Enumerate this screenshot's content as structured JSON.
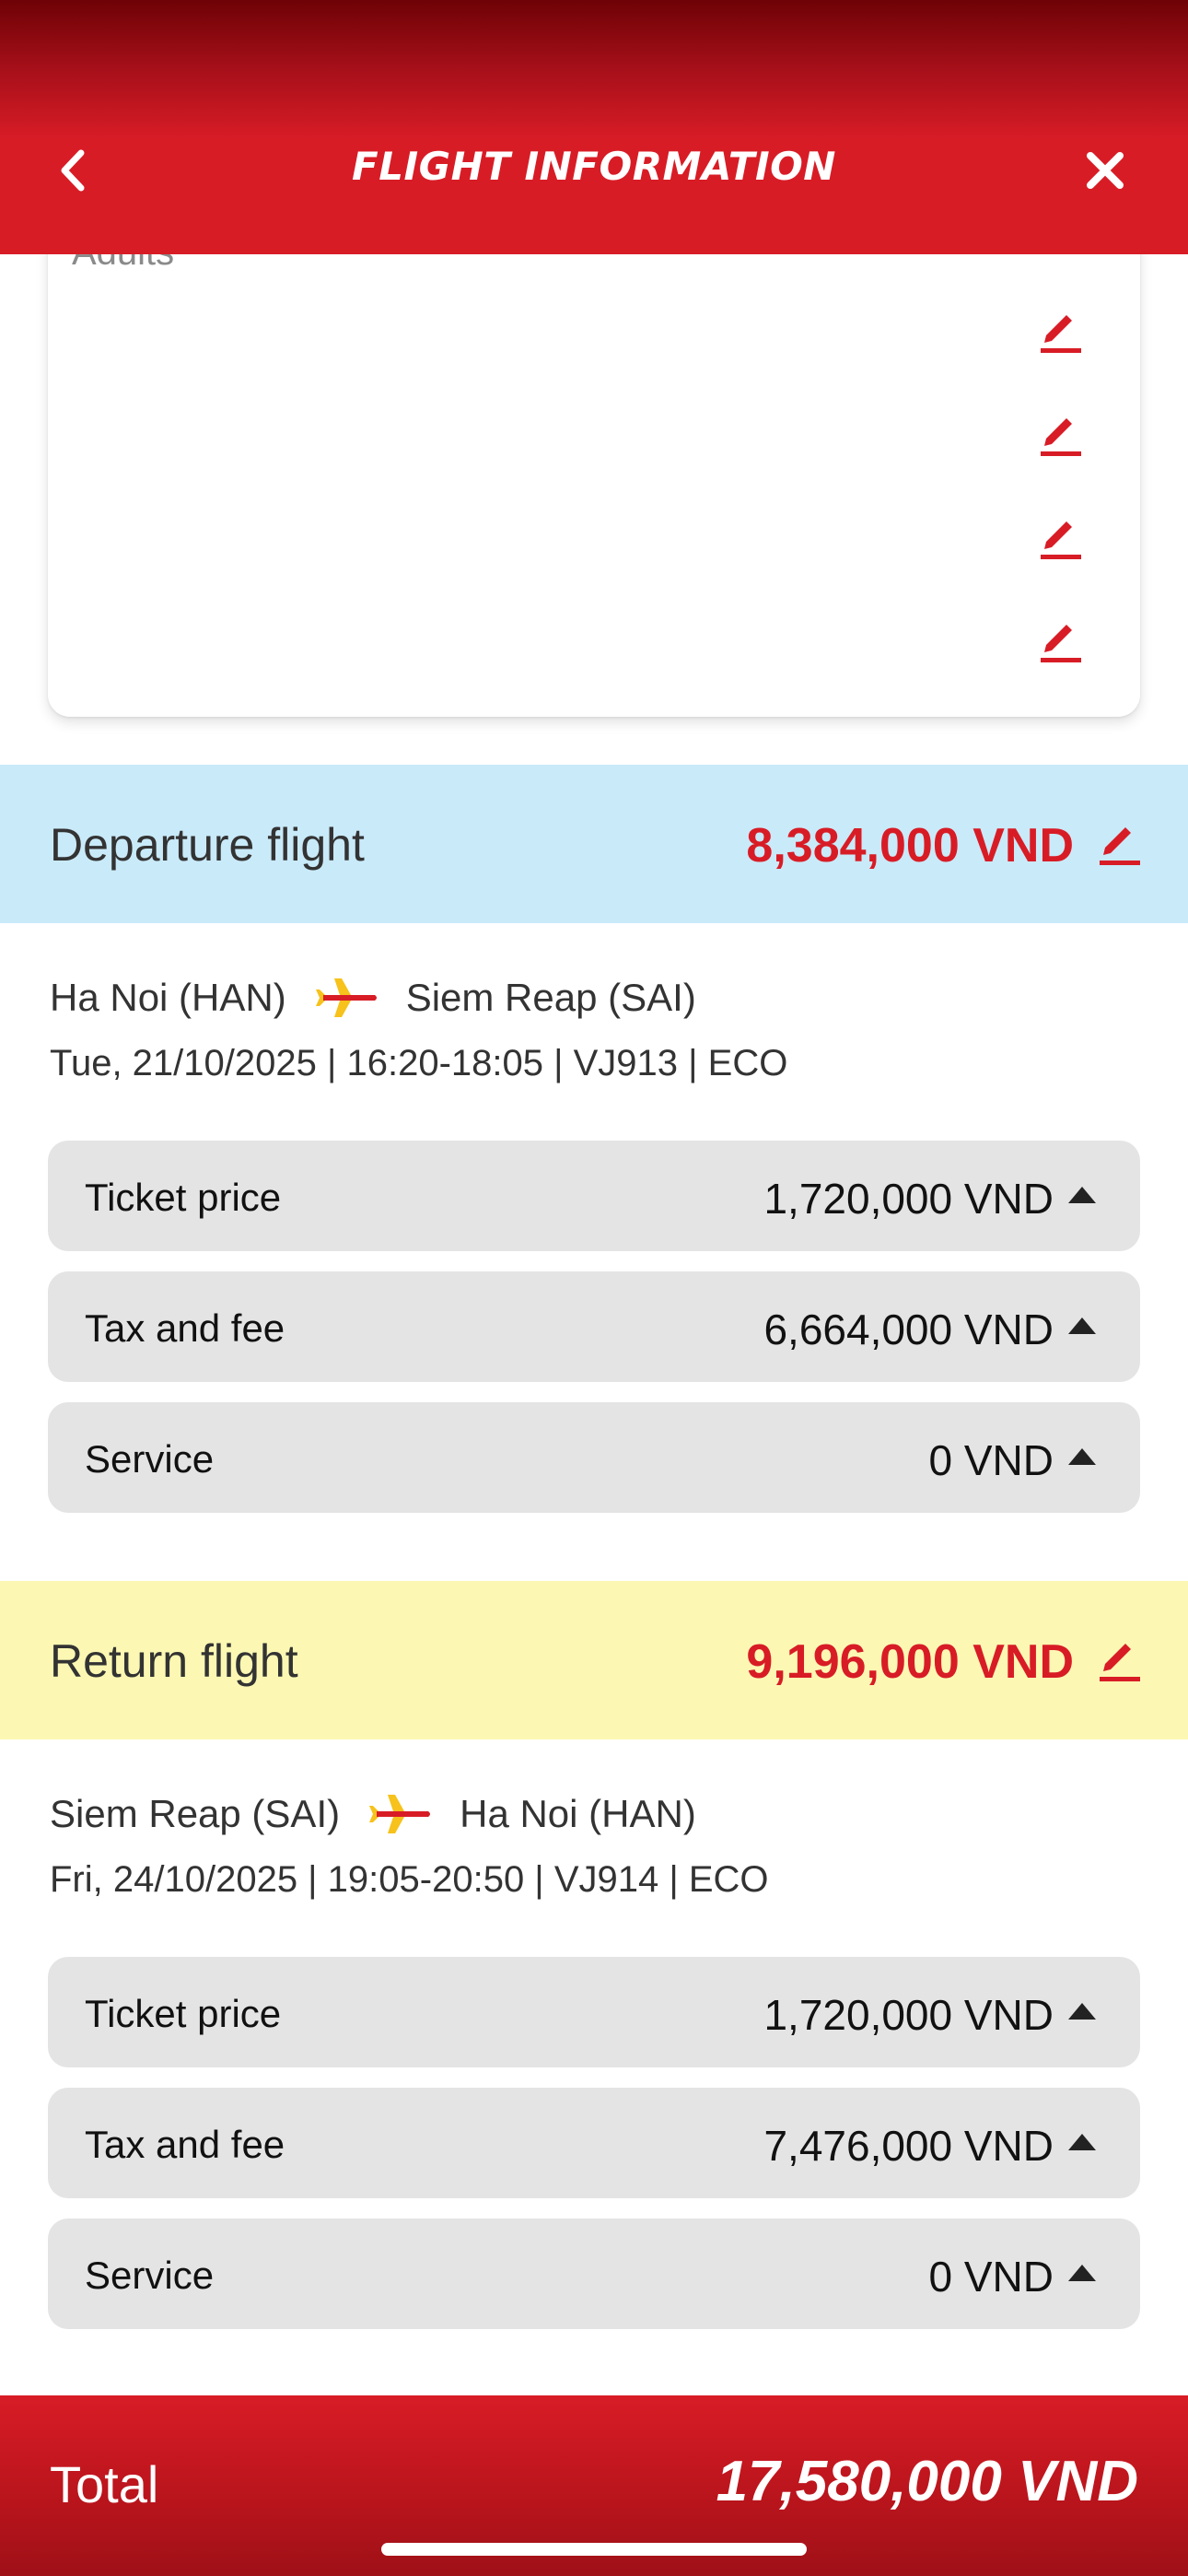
{
  "header": {
    "title": "FLIGHT INFORMATION",
    "back_icon": "chevron-left-icon",
    "close_icon": "close-icon"
  },
  "passengers": {
    "section_label": "Adults",
    "edit_icon": "pencil-icon"
  },
  "departure": {
    "label": "Departure flight",
    "total": "8,384,000 VND",
    "from": "Ha Noi (HAN)",
    "to": "Siem Reap (SAI)",
    "details": "Tue, 21/10/2025 | 16:20-18:05 | VJ913 | ECO",
    "rows": [
      {
        "label": "Ticket price",
        "value": "1,720,000 VND"
      },
      {
        "label": "Tax and fee",
        "value": "6,664,000 VND"
      },
      {
        "label": "Service",
        "value": "0 VND"
      }
    ]
  },
  "return": {
    "label": "Return flight",
    "total": "9,196,000 VND",
    "from": "Siem Reap (SAI)",
    "to": "Ha Noi (HAN)",
    "details": "Fri, 24/10/2025 | 19:05-20:50 | VJ914 | ECO",
    "rows": [
      {
        "label": "Ticket price",
        "value": "1,720,000 VND"
      },
      {
        "label": "Tax and fee",
        "value": "7,476,000 VND"
      },
      {
        "label": "Service",
        "value": "0 VND"
      }
    ]
  },
  "footer": {
    "total_label": "Total",
    "total_value": "17,580,000 VND"
  },
  "colors": {
    "brand_red": "#d81c26",
    "departure_band": "#c9eaf9",
    "return_band": "#fcf8b3",
    "row_bg": "#e4e4e4",
    "plane_yellow": "#f6c21b"
  }
}
